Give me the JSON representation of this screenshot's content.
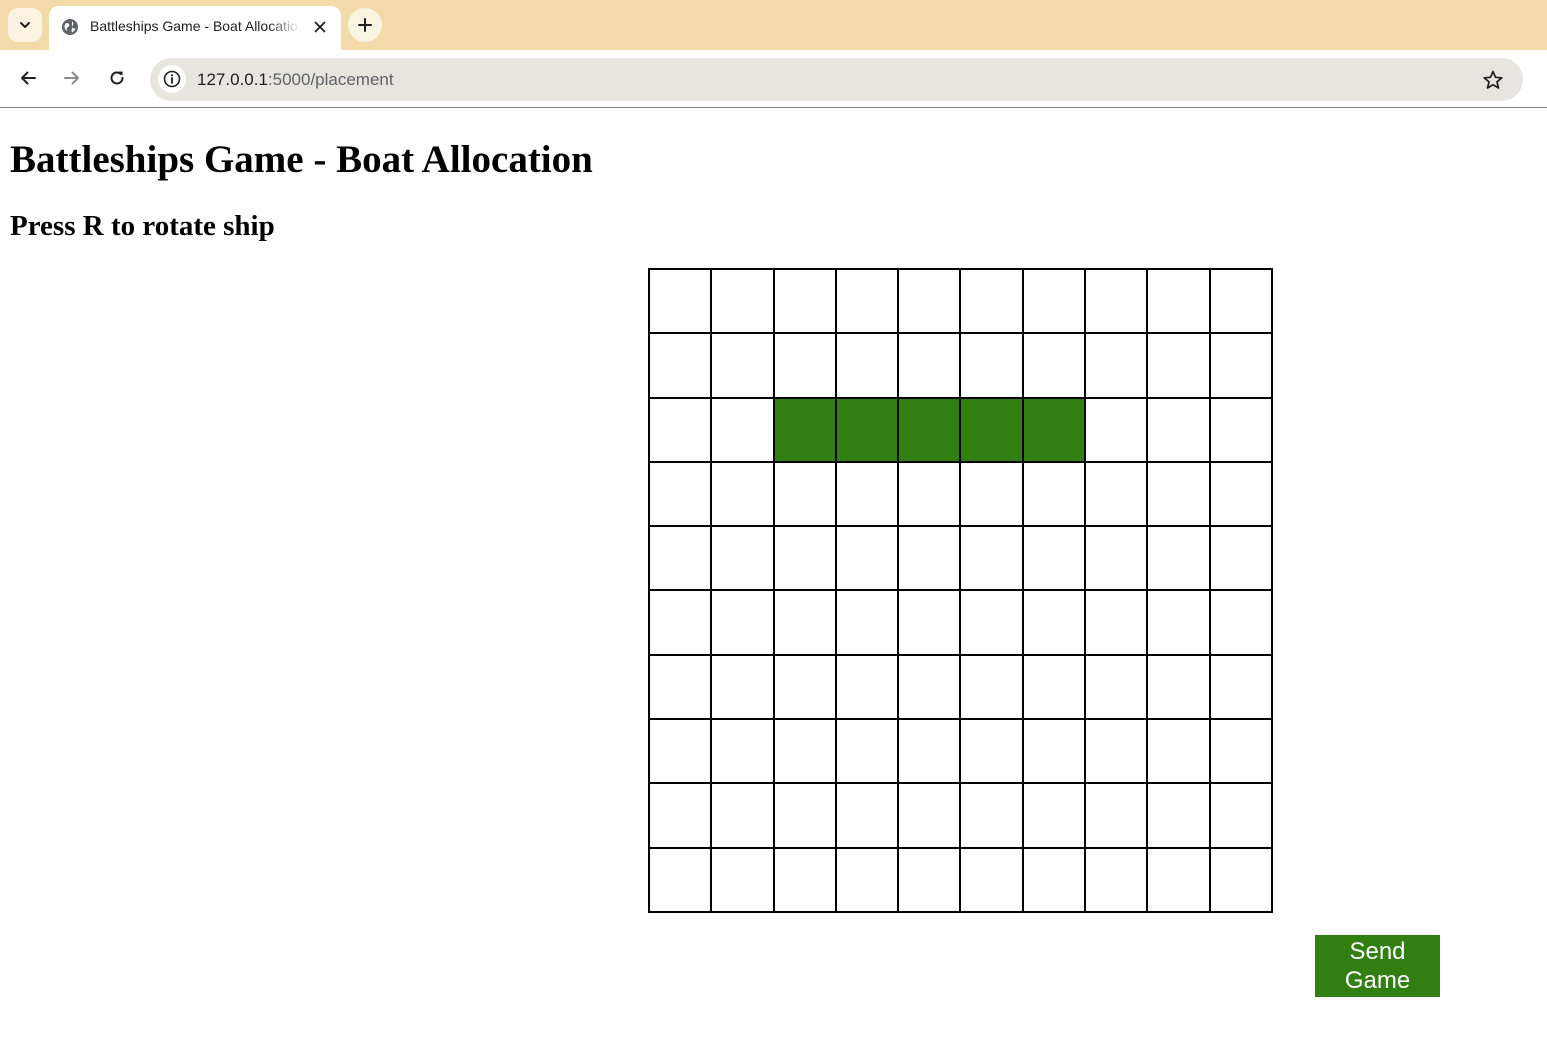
{
  "browser": {
    "tab": {
      "title": "Battleships Game - Boat Allocation"
    },
    "address_bar": {
      "url_host": "127.0.0.1",
      "url_path": ":5000/placement"
    },
    "icons": {
      "tab_list": "chevron-down-icon",
      "favicon": "globe-icon",
      "tab_close": "close-icon",
      "new_tab": "plus-icon",
      "back": "arrow-left-icon",
      "forward": "arrow-right-icon",
      "reload": "reload-icon",
      "site_info": "info-icon",
      "bookmark": "star-icon"
    }
  },
  "page": {
    "title": "Battleships Game - Boat Allocation",
    "instructions": "Press R to rotate ship",
    "board": {
      "rows": 10,
      "cols": 10,
      "ship_cells": [
        [
          2,
          2
        ],
        [
          2,
          3
        ],
        [
          2,
          4
        ],
        [
          2,
          5
        ],
        [
          2,
          6
        ]
      ],
      "ship_color": "#327f11",
      "empty_color": "#ffffff"
    },
    "send_button_label": "Send\nGame"
  },
  "colors": {
    "tab_strip": "#f2dba8",
    "accent_green": "#327f11"
  }
}
